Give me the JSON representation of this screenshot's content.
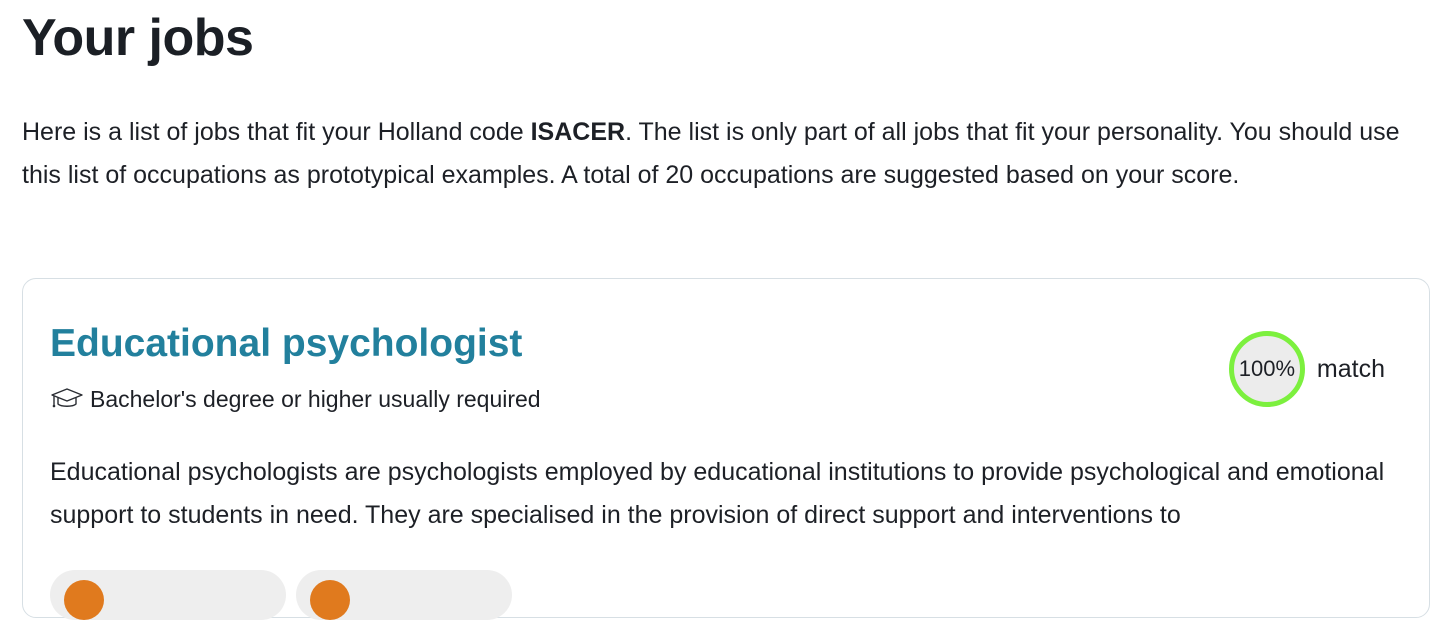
{
  "page": {
    "title": "Your jobs",
    "intro": {
      "before_code": "Here is a list of jobs that fit your Holland code ",
      "holland_code": "ISACER",
      "after_code": ". The list is only part of all jobs that fit your personality. You should use this list of occupations as prototypical examples. A total of 20 occupations are suggested based on your score."
    }
  },
  "job": {
    "title": "Educational psychologist",
    "education_icon": "graduation-cap-icon",
    "education": "Bachelor's degree or higher usually required",
    "match_percent": "100%",
    "match_value": 1.0,
    "match_label": "match",
    "description": "Educational psychologists are psychologists employed by educational institutions to provide psychological and emotional support to students in need. They are specialised in the provision of direct support and interventions to",
    "tags": [
      {
        "icon": "orange-circle-icon",
        "color": "#e07a1e"
      },
      {
        "icon": "orange-circle-icon",
        "color": "#e07a1e"
      }
    ]
  },
  "colors": {
    "title": "#1b1f25",
    "job_title": "#22809d",
    "match_ring": "#7cf03e",
    "match_fill": "#ececec",
    "card_border": "#d7dfe4",
    "tag_bg": "#eeeeee",
    "tag_dot": "#e07a1e"
  }
}
